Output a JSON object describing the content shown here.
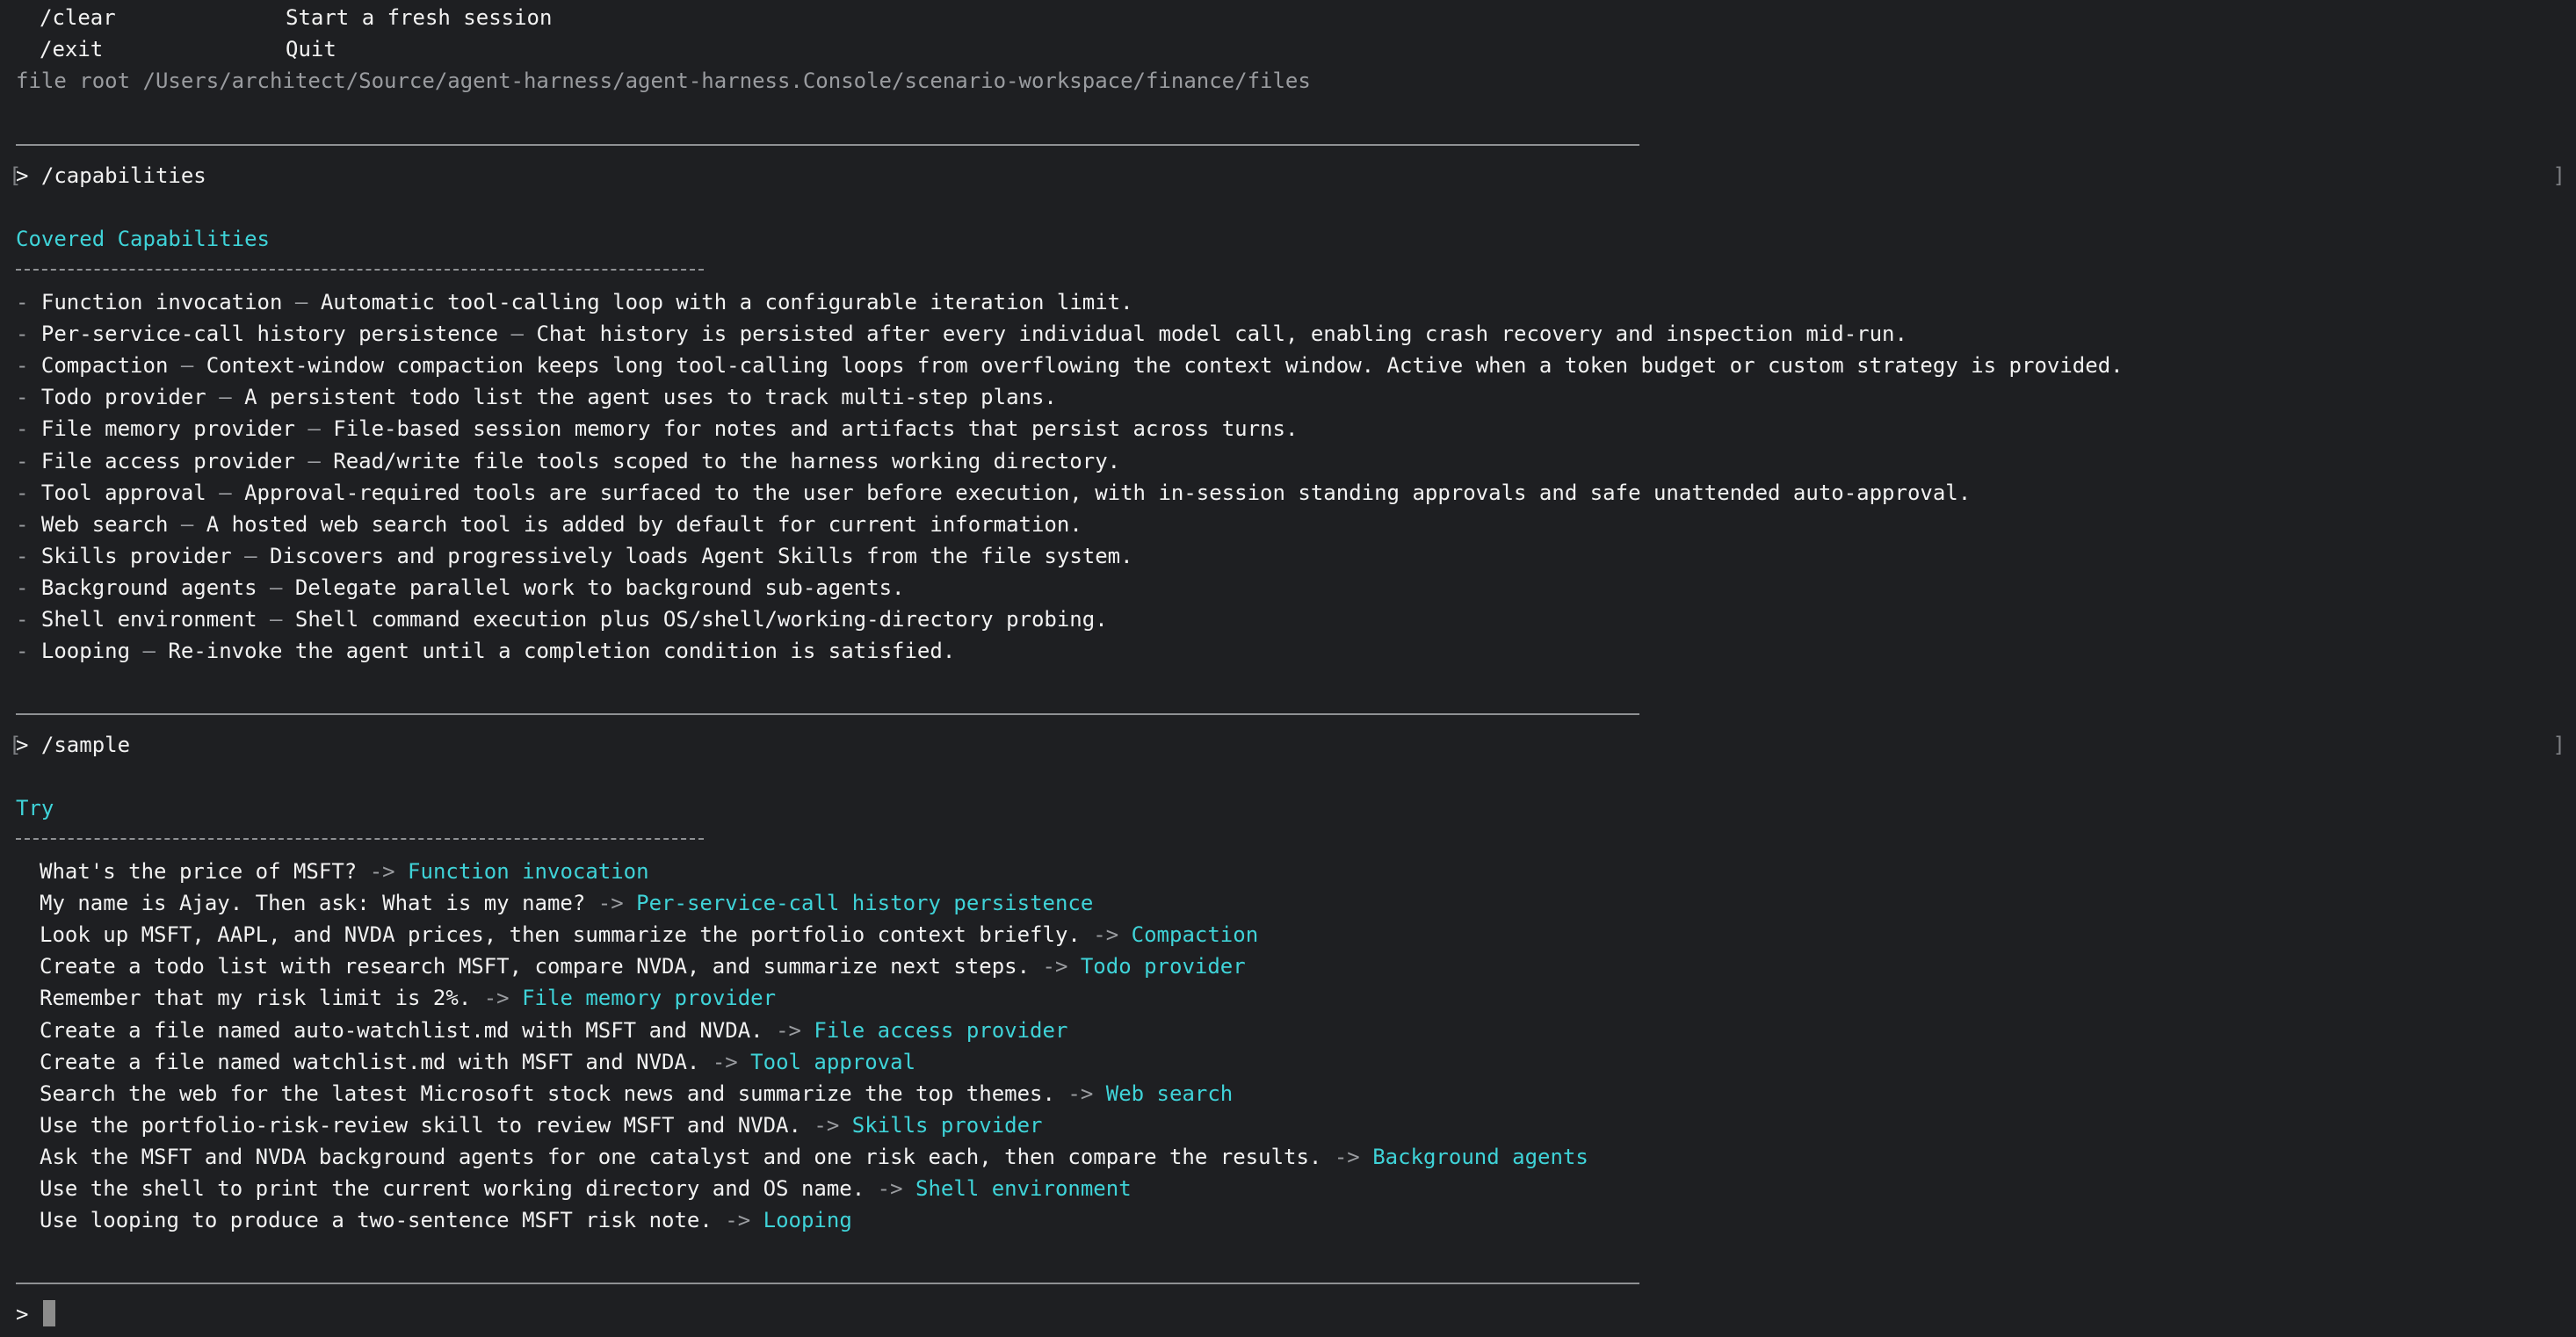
{
  "help": {
    "rows": [
      {
        "command": "/clear",
        "desc": "Start a fresh session"
      },
      {
        "command": "/exit",
        "desc": "Quit"
      }
    ],
    "file_root_label": "file root",
    "file_root_path": "/Users/architect/Source/agent-harness/agent-harness.Console/scenario-workspace/finance/files"
  },
  "prompt_symbol": ">",
  "command1": "/capabilities",
  "capabilities": {
    "title": "Covered Capabilities",
    "items": [
      {
        "name": "Function invocation",
        "desc": "Automatic tool-calling loop with a configurable iteration limit."
      },
      {
        "name": "Per-service-call history persistence",
        "desc": "Chat history is persisted after every individual model call, enabling crash recovery and inspection mid-run."
      },
      {
        "name": "Compaction",
        "desc": "Context-window compaction keeps long tool-calling loops from overflowing the context window. Active when a token budget or custom strategy is provided."
      },
      {
        "name": "Todo provider",
        "desc": "A persistent todo list the agent uses to track multi-step plans."
      },
      {
        "name": "File memory provider",
        "desc": "File-based session memory for notes and artifacts that persist across turns."
      },
      {
        "name": "File access provider",
        "desc": "Read/write file tools scoped to the harness working directory."
      },
      {
        "name": "Tool approval",
        "desc": "Approval-required tools are surfaced to the user before execution, with in-session standing approvals and safe unattended auto-approval."
      },
      {
        "name": "Web search",
        "desc": "A hosted web search tool is added by default for current information."
      },
      {
        "name": "Skills provider",
        "desc": "Discovers and progressively loads Agent Skills from the file system."
      },
      {
        "name": "Background agents",
        "desc": "Delegate parallel work to background sub-agents."
      },
      {
        "name": "Shell environment",
        "desc": "Shell command execution plus OS/shell/working-directory probing."
      },
      {
        "name": "Looping",
        "desc": "Re-invoke the agent until a completion condition is satisfied."
      }
    ]
  },
  "command2": "/sample",
  "samples": {
    "title": "Try",
    "arrow": "->",
    "items": [
      {
        "text": "What's the price of MSFT?",
        "capability": "Function invocation"
      },
      {
        "text": "My name is Ajay. Then ask: What is my name?",
        "capability": "Per-service-call history persistence"
      },
      {
        "text": "Look up MSFT, AAPL, and NVDA prices, then summarize the portfolio context briefly.",
        "capability": "Compaction"
      },
      {
        "text": "Create a todo list with research MSFT, compare NVDA, and summarize next steps.",
        "capability": "Todo provider"
      },
      {
        "text": "Remember that my risk limit is 2%.",
        "capability": "File memory provider"
      },
      {
        "text": "Create a file named auto-watchlist.md with MSFT and NVDA.",
        "capability": "File access provider"
      },
      {
        "text": "Create a file named watchlist.md with MSFT and NVDA.",
        "capability": "Tool approval"
      },
      {
        "text": "Search the web for the latest Microsoft stock news and summarize the top themes.",
        "capability": "Web search"
      },
      {
        "text": "Use the portfolio-risk-review skill to review MSFT and NVDA.",
        "capability": "Skills provider"
      },
      {
        "text": "Ask the MSFT and NVDA background agents for one catalyst and one risk each, then compare the results.",
        "capability": "Background agents"
      },
      {
        "text": "Use the shell to print the current working directory and OS name.",
        "capability": "Shell environment"
      },
      {
        "text": "Use looping to produce a two-sentence MSFT risk note.",
        "capability": "Looping"
      }
    ]
  },
  "input": {
    "value": ""
  }
}
